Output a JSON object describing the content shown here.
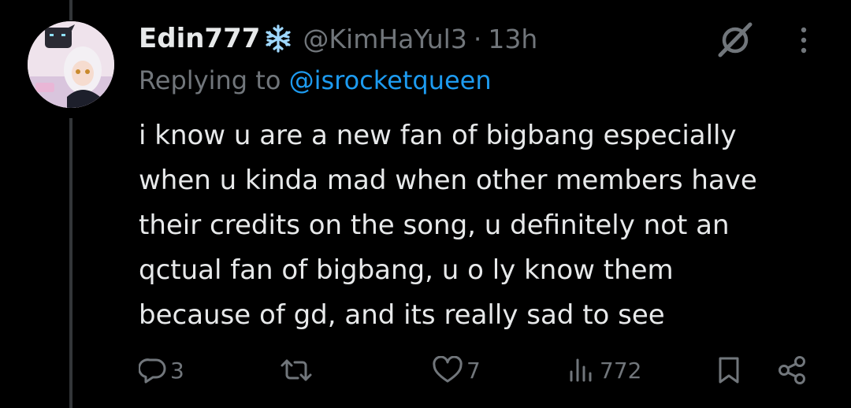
{
  "tweet": {
    "display_name": "Edin777",
    "name_emoji_icon": "snowflake-icon",
    "handle": "@KimHaYul3",
    "separator": "·",
    "time": "13h",
    "replying_prefix": "Replying to",
    "replying_handle": "@isrocketqueen",
    "body_lines": [
      "i know u are a new fan of bigbang especially",
      "when u kinda mad when other members have",
      "their credits on the song, u definitely not an",
      "qctual fan of bigbang, u o ly know them",
      "because of gd, and its really sad to see"
    ]
  },
  "actions": {
    "reply_count": "3",
    "retweet_count": "",
    "like_count": "7",
    "views_count": "772"
  },
  "colors": {
    "background": "#000000",
    "text_primary": "#e7e9ea",
    "text_secondary": "#71767b",
    "link": "#1d9bf0",
    "thread_line": "#333639"
  },
  "icons": [
    "grok-icon",
    "more-icon",
    "reply-icon",
    "retweet-icon",
    "like-icon",
    "views-icon",
    "bookmark-icon",
    "share-icon"
  ]
}
